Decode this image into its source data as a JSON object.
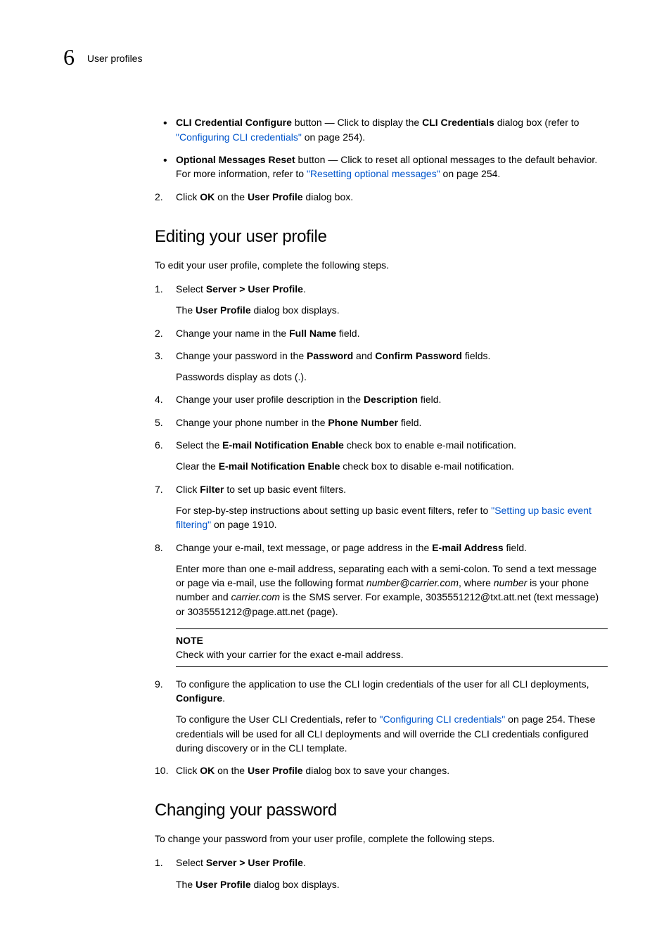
{
  "header": {
    "chapter_number": "6",
    "breadcrumb": "User profiles"
  },
  "top_bullets": [
    {
      "bold1": "CLI Credential Configure",
      "t1": " button — Click to display the ",
      "bold2": "CLI Credentials",
      "t2": " dialog box (refer to ",
      "link": "\"Configuring CLI credentials\"",
      "t3": " on page 254)."
    },
    {
      "bold1": "Optional Messages Reset",
      "t1": " button — Click to reset all optional messages to the default behavior. For more information, refer to ",
      "link": "\"Resetting optional messages\"",
      "t2": " on page 254."
    }
  ],
  "top_step2": {
    "num": "2.",
    "t1": "Click ",
    "b1": "OK",
    "t2": " on the ",
    "b2": "User Profile",
    "t3": " dialog box."
  },
  "h_editing": "Editing your user profile",
  "editing_intro": "To edit your user profile, complete the following steps.",
  "edit_steps": {
    "s1": {
      "num": "1.",
      "t1": "Select ",
      "b1": "Server > User Profile",
      "t2": ".",
      "sub_t1": "The ",
      "sub_b1": "User Profile",
      "sub_t2": " dialog box displays."
    },
    "s2": {
      "num": "2.",
      "t1": "Change your name in the ",
      "b1": "Full Name",
      "t2": " field."
    },
    "s3": {
      "num": "3.",
      "t1": "Change your password in the ",
      "b1": "Password",
      "t2": " and ",
      "b2": "Confirm Password",
      "t3": " fields.",
      "sub": "Passwords display as dots (.)."
    },
    "s4": {
      "num": "4.",
      "t1": "Change your user profile description in the ",
      "b1": "Description",
      "t2": " field."
    },
    "s5": {
      "num": "5.",
      "t1": "Change your phone number in the ",
      "b1": "Phone Number",
      "t2": " field."
    },
    "s6": {
      "num": "6.",
      "t1": "Select the ",
      "b1": "E-mail Notification Enable",
      "t2": " check box to enable e-mail notification.",
      "sub_t1": "Clear the ",
      "sub_b1": "E-mail Notification Enable",
      "sub_t2": " check box to disable e-mail notification."
    },
    "s7": {
      "num": "7.",
      "t1": "Click ",
      "b1": "Filter",
      "t2": " to set up basic event filters.",
      "sub_t1": "For step-by-step instructions about setting up basic event filters, refer to ",
      "sub_link": "\"Setting up basic event filtering\"",
      "sub_t2": " on page 1910."
    },
    "s8": {
      "num": "8.",
      "t1": "Change your e-mail, text message, or page address in the ",
      "b1": "E-mail Address",
      "t2": " field.",
      "sub_t1": "Enter more than one e-mail address, separating each with a semi-colon. To send a text message or page via e-mail, use the following format ",
      "sub_i1": "number@carrier.com",
      "sub_t2": ", where ",
      "sub_i2": "number",
      "sub_t3": " is your phone number and ",
      "sub_i3": "carrier.com",
      "sub_t4": " is the SMS server. For example, 3035551212@txt.att.net (text message) or 3035551212@page.att.net (page).",
      "note_label": "NOTE",
      "note_text": "Check with your carrier for the exact e-mail address."
    },
    "s9": {
      "num": "9.",
      "t1": "To configure the application to use the CLI login credentials of the user for all CLI deployments, ",
      "b1": "Configure",
      "t2": ".",
      "sub_t1": "To configure the User CLI Credentials, refer to ",
      "sub_link": "\"Configuring CLI credentials\"",
      "sub_t2": " on page 254. These credentials will be used for all CLI deployments and will override the CLI credentials configured during discovery or in the CLI template."
    },
    "s10": {
      "num": "10.",
      "t1": "Click ",
      "b1": "OK",
      "t2": " on the ",
      "b2": "User Profile",
      "t3": " dialog box to save your changes."
    }
  },
  "h_password": "Changing your password",
  "password_intro": "To change your password from your user profile, complete the following steps.",
  "pw_steps": {
    "s1": {
      "num": "1.",
      "t1": "Select ",
      "b1": "Server > User Profile",
      "t2": ".",
      "sub_t1": "The ",
      "sub_b1": "User Profile",
      "sub_t2": " dialog box displays."
    }
  }
}
